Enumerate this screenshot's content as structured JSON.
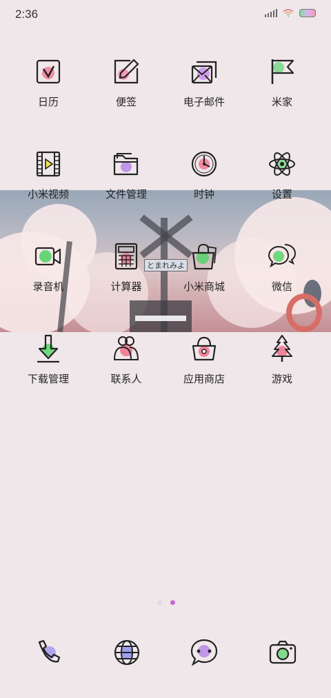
{
  "status": {
    "time": "2:36"
  },
  "rows": [
    [
      {
        "name": "calendar",
        "label": "日历"
      },
      {
        "name": "notes",
        "label": "便签"
      },
      {
        "name": "email",
        "label": "电子邮件"
      },
      {
        "name": "mijia",
        "label": "米家"
      }
    ],
    [
      {
        "name": "mi-video",
        "label": "小米视频"
      },
      {
        "name": "file-manager",
        "label": "文件管理"
      },
      {
        "name": "clock",
        "label": "时钟"
      },
      {
        "name": "settings",
        "label": "设置"
      }
    ],
    [
      {
        "name": "recorder",
        "label": "录音机"
      },
      {
        "name": "calculator",
        "label": "计算器"
      },
      {
        "name": "mi-store",
        "label": "小米商城"
      },
      {
        "name": "wechat",
        "label": "微信"
      }
    ],
    [
      {
        "name": "download-manager",
        "label": "下载管理"
      },
      {
        "name": "contacts",
        "label": "联系人"
      },
      {
        "name": "app-store",
        "label": "应用商店"
      },
      {
        "name": "games",
        "label": "游戏"
      }
    ]
  ],
  "banner_sign_text": "とまれみよ",
  "page_indicator": {
    "pages": 2,
    "active": 2,
    "active_color": "#c46ad8",
    "inactive_color": "#dcd6e0"
  },
  "dock": [
    "phone",
    "browser",
    "messages",
    "camera"
  ]
}
